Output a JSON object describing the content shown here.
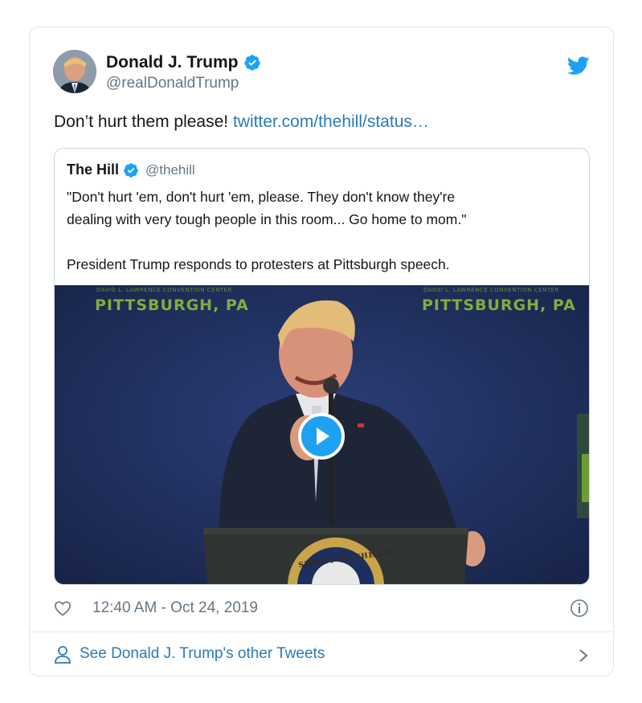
{
  "author": {
    "name": "Donald J. Trump",
    "handle": "@realDonaldTrump"
  },
  "tweet": {
    "text": "Don’t hurt them please! ",
    "link": "twitter.com/thehill/status…"
  },
  "quoted_tweet": {
    "name": "The Hill",
    "handle": "@thehill",
    "text_line1": "\"Don't hurt 'em, don't hurt 'em, please. They don't know they're",
    "text_line2": "dealing with very tough people in this room... Go home to mom.\"",
    "text_line3": "President Trump responds to protesters at Pittsburgh speech.",
    "media": {
      "sign_left": "PITTSBURGH, PA",
      "sign_right": "PITTSBURGH, PA",
      "sign_small_left": "DAVID L. LAWRENCE CONVENTION CENTER",
      "sign_small_right": "DAVID L. LAWRENCE CONVENTION CENTER",
      "seal_text": "SIDENT OF THE UN"
    }
  },
  "meta": {
    "timestamp": "12:40 AM - Oct 24, 2019"
  },
  "footer": {
    "link_text": "See Donald J. Trump's other Tweets"
  },
  "colors": {
    "link": "#2b7bb9",
    "twitter_blue": "#1da1f2",
    "secondary_text": "#657786",
    "border": "#e1e8ed"
  },
  "icons": {
    "verified": "verified-badge-icon",
    "bird": "twitter-bird-icon",
    "heart": "heart-icon",
    "info": "info-icon",
    "person": "person-icon",
    "chevron": "chevron-right-icon",
    "play": "play-icon"
  }
}
